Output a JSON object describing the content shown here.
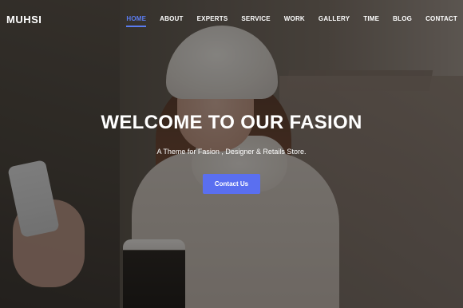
{
  "brand": {
    "logo": "MUHSI"
  },
  "nav": {
    "items": [
      {
        "label": "HOME",
        "active": true
      },
      {
        "label": "ABOUT"
      },
      {
        "label": "EXPERTS"
      },
      {
        "label": "SERVICE"
      },
      {
        "label": "WORK"
      },
      {
        "label": "GALLERY"
      },
      {
        "label": "TIME"
      },
      {
        "label": "BLOG"
      },
      {
        "label": "CONTACT"
      }
    ]
  },
  "hero": {
    "title": "WELCOME TO OUR FASION",
    "subtitle": "A Theme for Fasion , Designer & Retails Store.",
    "cta_label": "Contact Us"
  },
  "colors": {
    "accent": "#5a6ff0",
    "text": "#ffffff"
  }
}
